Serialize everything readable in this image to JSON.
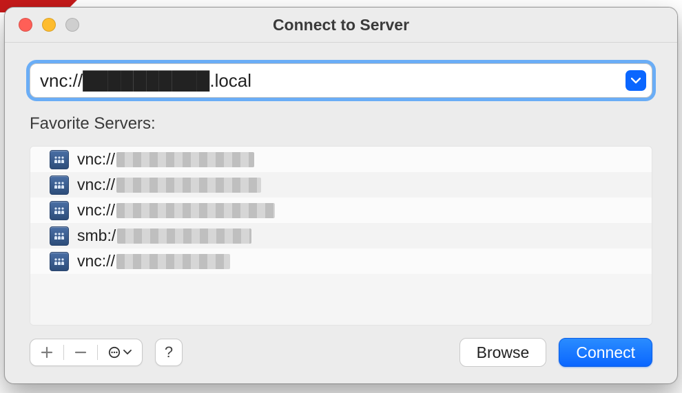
{
  "window": {
    "title": "Connect to Server"
  },
  "address": {
    "value": "vnc://██████████.local"
  },
  "section": {
    "favorites_label": "Favorite Servers:"
  },
  "favorites": [
    {
      "prefix": "vnc://",
      "redactedWidth": 200
    },
    {
      "prefix": "vnc://",
      "redactedWidth": 210
    },
    {
      "prefix": "vnc://",
      "redactedWidth": 230
    },
    {
      "prefix": "smb:/",
      "redactedWidth": 195
    },
    {
      "prefix": "vnc://",
      "redactedWidth": 165
    }
  ],
  "footer": {
    "help_label": "?",
    "browse_label": "Browse",
    "connect_label": "Connect"
  }
}
